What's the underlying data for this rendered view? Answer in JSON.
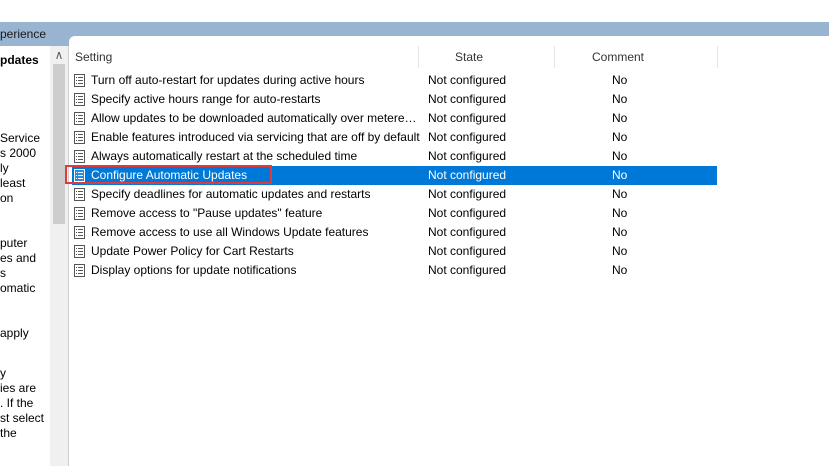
{
  "window": {
    "breadcrumb": "perience"
  },
  "left_pane": {
    "title": "pdates",
    "description_lines": [
      "",
      "Service",
      "s 2000",
      "ly",
      "least",
      "on",
      "",
      "puter",
      "es and",
      "s",
      "omatic",
      "",
      "apply",
      "",
      "y",
      "ies are",
      ". If the",
      "st select",
      "the"
    ]
  },
  "columns": {
    "setting": "Setting",
    "state": "State",
    "comment": "Comment"
  },
  "rows": [
    {
      "name": "Turn off auto-restart for updates during active hours",
      "state": "Not configured",
      "comment": "No",
      "selected": false
    },
    {
      "name": "Specify active hours range for auto-restarts",
      "state": "Not configured",
      "comment": "No",
      "selected": false
    },
    {
      "name": "Allow updates to be downloaded automatically over metered connections",
      "state": "Not configured",
      "comment": "No",
      "selected": false
    },
    {
      "name": "Enable features introduced via servicing that are off by default",
      "state": "Not configured",
      "comment": "No",
      "selected": false
    },
    {
      "name": "Always automatically restart at the scheduled time",
      "state": "Not configured",
      "comment": "No",
      "selected": false
    },
    {
      "name": "Configure Automatic Updates",
      "state": "Not configured",
      "comment": "No",
      "selected": true
    },
    {
      "name": "Specify deadlines for automatic updates and restarts",
      "state": "Not configured",
      "comment": "No",
      "selected": false
    },
    {
      "name": "Remove access to \"Pause updates\" feature",
      "state": "Not configured",
      "comment": "No",
      "selected": false
    },
    {
      "name": "Remove access to use all Windows Update features",
      "state": "Not configured",
      "comment": "No",
      "selected": false
    },
    {
      "name": "Update Power Policy for Cart Restarts",
      "state": "Not configured",
      "comment": "No",
      "selected": false
    },
    {
      "name": "Display options for update notifications",
      "state": "Not configured",
      "comment": "No",
      "selected": false
    }
  ],
  "colors": {
    "selection": "#0078d7",
    "annotation_box": "#e0393e",
    "breadcrumb_bar": "#99b4d1"
  },
  "icons": {
    "row_icon": "policy-setting-icon",
    "scroll_up": "scroll-up-arrow-icon"
  }
}
